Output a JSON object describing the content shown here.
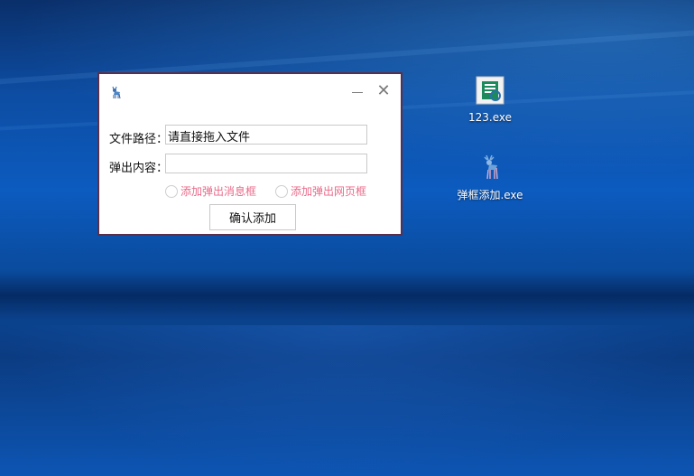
{
  "dialog": {
    "file_path_label": "文件路径：",
    "file_path_value": "请直接拖入文件",
    "popup_content_label": "弹出内容：",
    "popup_content_value": "",
    "radio_message_box": "添加弹出消息框",
    "radio_web_box": "添加弹出网页框",
    "confirm_button": "确认添加",
    "close_glyph": "✕",
    "accent_color": "#5a2f4a"
  },
  "desktop": {
    "icons": [
      {
        "label": "123.exe",
        "icon": "installer-icon"
      },
      {
        "label": "弹框添加.exe",
        "icon": "deer-icon"
      }
    ]
  }
}
